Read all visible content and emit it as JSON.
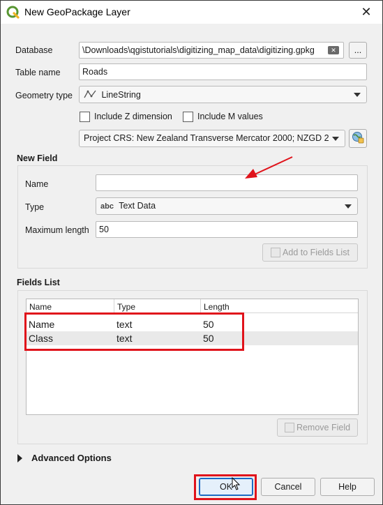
{
  "window": {
    "title": "New GeoPackage Layer"
  },
  "form": {
    "database_label": "Database",
    "database_value": "\\Downloads\\qgistutorials\\digitizing_map_data\\digitizing.gpkg",
    "browse_label": "...",
    "table_name_label": "Table name",
    "table_name_value": "Roads",
    "geometry_type_label": "Geometry type",
    "geometry_type_value": "LineString",
    "include_z_label": "Include Z dimension",
    "include_m_label": "Include M values",
    "crs_value": "Project CRS: New Zealand Transverse Mercator 2000; NZGD 2"
  },
  "new_field": {
    "title": "New Field",
    "name_label": "Name",
    "name_value": "",
    "type_label": "Type",
    "type_prefix": "abc",
    "type_value": "Text Data",
    "max_length_label": "Maximum length",
    "max_length_value": "50",
    "add_button_label": "Add to Fields List"
  },
  "fields_list": {
    "title": "Fields List",
    "columns": [
      "Name",
      "Type",
      "Length"
    ],
    "rows": [
      {
        "name": "Name",
        "type": "text",
        "length": "50"
      },
      {
        "name": "Class",
        "type": "text",
        "length": "50"
      }
    ],
    "remove_button_label": "Remove Field"
  },
  "advanced": {
    "label": "Advanced Options"
  },
  "footer": {
    "ok_label": "OK",
    "cancel_label": "Cancel",
    "help_label": "Help"
  },
  "colors": {
    "annotation_red": "#e0131b",
    "qgis_green": "#6aa84f"
  }
}
